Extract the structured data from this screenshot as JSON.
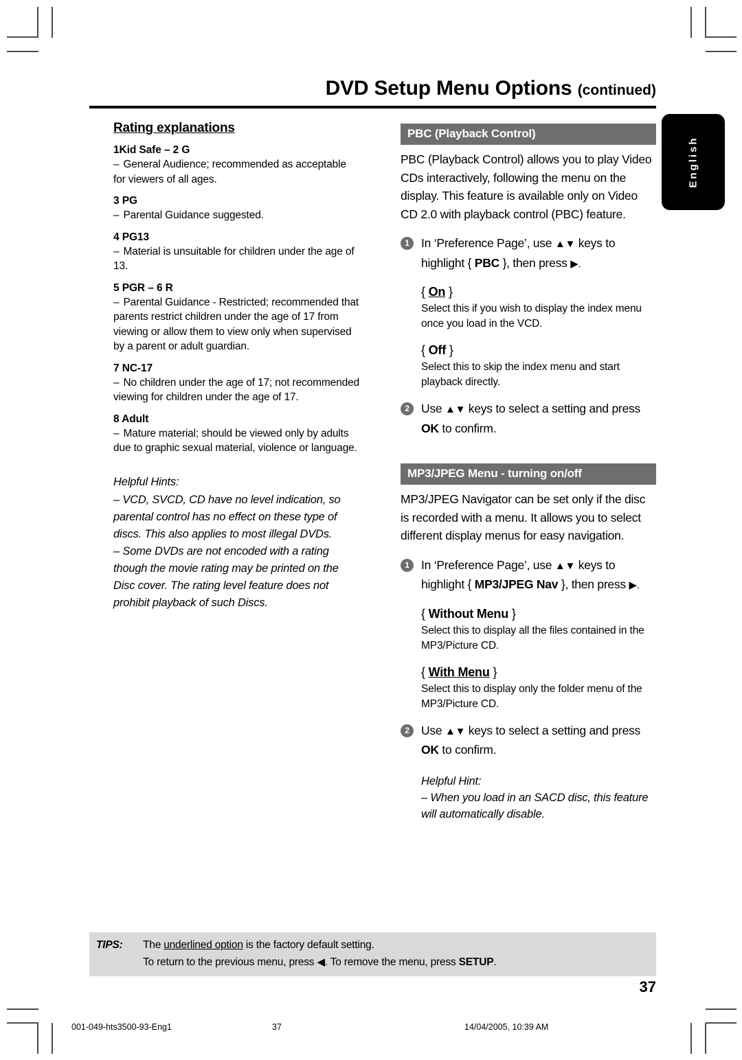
{
  "header": {
    "title": "DVD Setup Menu Options",
    "continued": "(continued)"
  },
  "language_tab": {
    "label": "English"
  },
  "left_column": {
    "section_heading": "Rating explanations",
    "ratings": [
      {
        "title": "1Kid Safe – 2 G",
        "dash": "–",
        "body": "General Audience; recommended as acceptable for viewers of all ages."
      },
      {
        "title": "3 PG",
        "dash": "–",
        "body": "Parental Guidance suggested."
      },
      {
        "title": "4 PG13",
        "dash": "–",
        "body": "Material is unsuitable for children under the age of 13."
      },
      {
        "title": "5 PGR – 6 R",
        "dash": "–",
        "body": "Parental Guidance - Restricted; recommended that parents restrict children under the age of 17 from viewing or allow them to view only when supervised by a parent or adult guardian."
      },
      {
        "title": "7 NC-17",
        "dash": "–",
        "body": "No children under the age of 17; not recommended viewing for children under the age of 17."
      },
      {
        "title": "8  Adult",
        "dash": "–",
        "body": "Mature material; should be viewed only by adults due to graphic sexual material, violence or language."
      }
    ],
    "helpful_hints": {
      "title": "Helpful Hints:",
      "items": [
        "–  VCD, SVCD, CD have no level indication, so parental control has no effect on these type of discs. This also applies to most illegal DVDs.",
        "–  Some DVDs are not encoded with a rating though the movie rating may be printed on the Disc cover. The rating level feature does not prohibit playback of such Discs."
      ]
    }
  },
  "right_column": {
    "pbc_section": {
      "bar_title": "PBC (Playback Control)",
      "intro": "PBC (Playback Control) allows you to play Video CDs interactively, following the menu on the display. This feature is available only on Video CD 2.0 with playback control (PBC) feature.",
      "step1_num": "1",
      "step1_prefix": "In ‘Preference Page’, use ",
      "step1_keys": "▲▼",
      "step1_mid": " keys to highlight { ",
      "step1_item": "PBC",
      "step1_suffix": " }, then press ",
      "step1_arrow": "▶.",
      "options": [
        {
          "open": "{ ",
          "label": "On",
          "underlined": true,
          "close": " }",
          "desc": "Select this if you wish to display the index menu once you load in the VCD."
        },
        {
          "open": "{ ",
          "label": "Off",
          "underlined": false,
          "close": " }",
          "desc": "Select this to skip the index menu and start playback directly."
        }
      ],
      "step2_num": "2",
      "step2_prefix": "Use ",
      "step2_keys": "▲▼",
      "step2_mid": " keys to select a setting and press ",
      "step2_ok": "OK",
      "step2_suffix": " to confirm."
    },
    "mp3_section": {
      "bar_title": "MP3/JPEG Menu - turning on/off",
      "intro": "MP3/JPEG Navigator can be set only if the disc is recorded with a menu.  It allows you to select different display menus for easy navigation.",
      "step1_num": "1",
      "step1_prefix": "In ‘Preference Page’, use ",
      "step1_keys": "▲▼",
      "step1_mid": " keys to highlight { ",
      "step1_item": "MP3/JPEG Nav",
      "step1_suffix": " }, then press ",
      "step1_arrow": "▶.",
      "options": [
        {
          "open": "{ ",
          "label": "Without Menu",
          "underlined": false,
          "close": " }",
          "desc": "Select this to display all the files contained in the MP3/Picture CD."
        },
        {
          "open": "{ ",
          "label": "With Menu",
          "underlined": true,
          "close": " }",
          "desc": "Select this to display only the folder menu of the MP3/Picture CD."
        }
      ],
      "step2_num": "2",
      "step2_prefix": "Use ",
      "step2_keys": "▲▼",
      "step2_mid": " keys to select a setting and press ",
      "step2_ok": "OK",
      "step2_suffix": " to confirm.",
      "hint": {
        "title": "Helpful Hint:",
        "text": "–  When you load in an SACD disc, this feature will automatically disable."
      }
    }
  },
  "tips": {
    "label": "TIPS:",
    "line1_pre": "The ",
    "line1_underlined": "underlined option",
    "line1_post": " is the factory default setting.",
    "line2_pre": "To return to the previous menu, press ",
    "line2_arrow": "◀",
    "line2_mid": ".  To remove the menu, press ",
    "line2_setup": "SETUP",
    "line2_post": "."
  },
  "page_number": "37",
  "print_footer": {
    "file": "001-049-hts3500-93-Eng1",
    "page": "37",
    "date": "14/04/2005, 10:39 AM"
  }
}
